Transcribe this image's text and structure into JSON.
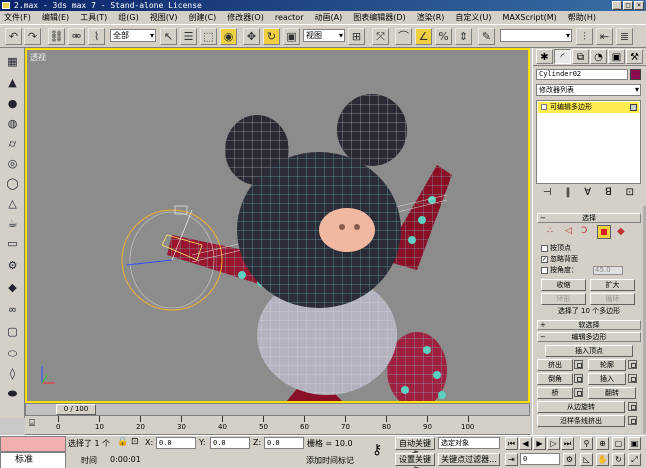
{
  "title": "2.max - 3ds max 7  - Stand-alone License",
  "window_buttons": [
    "_",
    "□",
    "×"
  ],
  "menu": [
    "文件(F)",
    "编辑(E)",
    "工具(T)",
    "组(G)",
    "视图(V)",
    "创建(C)",
    "修改器(O)",
    "reactor",
    "动画(A)",
    "图表编辑器(D)",
    "渲染(R)",
    "自定义(U)",
    "MAXScript(M)",
    "帮助(H)"
  ],
  "toolbar": {
    "selection_filter": "全部",
    "ref_coord": "视图"
  },
  "viewport": {
    "label": "透视",
    "border_color": "#ffe000"
  },
  "timeslider": {
    "position": "0 / 100",
    "frame": 0,
    "total": 100
  },
  "trackbar": {
    "ticks": [
      "0",
      "10",
      "20",
      "30",
      "40",
      "50",
      "60",
      "70",
      "80",
      "90",
      "100"
    ]
  },
  "command_panel": {
    "object_name": "Cylinder02",
    "object_color": "#8b0a50",
    "modifier_list": "修改器列表",
    "stack_item": "可编辑多边形",
    "selection": {
      "title": "选择",
      "by_vertex": "按顶点",
      "ignore_backfacing": "忽略背面",
      "by_angle": "按角度：",
      "angle_value": "45.0",
      "shrink": "收缩",
      "grow": "扩大",
      "ring": "环形",
      "loop": "循环",
      "selected_count": "选择了 10 个多边形"
    },
    "soft_selection": {
      "title": "软选择"
    },
    "edit_polygons": {
      "title": "编辑多边形",
      "insert_vertex": "插入顶点",
      "extrude": "挤出",
      "outline": "轮廓",
      "bevel": "倒角",
      "inset": "插入",
      "bridge": "桥",
      "flip": "翻转",
      "hinge_from_edge": "从边旋转",
      "extrude_along_spline": "沿样条线挤出"
    }
  },
  "status": {
    "selected": "选择了 1 个",
    "x_label": "X:",
    "x_value": "0.0",
    "y_label": "Y:",
    "y_value": "0.0",
    "z_label": "Z:",
    "z_value": "0.0",
    "grid": "栅格 = 10.0",
    "auto_key": "自动关键点",
    "selected_object": "选定对象",
    "set_key": "设置关键点",
    "key_filters": "关键点过滤器...",
    "standard": "标准",
    "time_label": "时间",
    "time_value": "0:00:01",
    "add_time_tag": "添加时间标记",
    "frame_value": "0"
  }
}
